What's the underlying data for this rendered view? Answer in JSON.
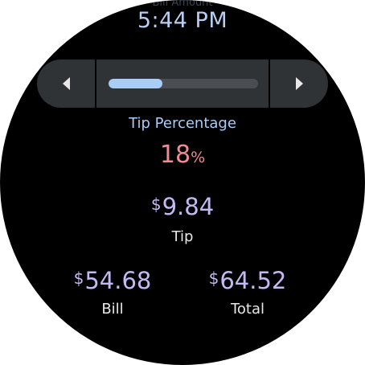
{
  "header": {
    "scrolled_label": "Bill Amount",
    "time": "5:44 PM"
  },
  "stepper": {
    "decrease_icon": "triangle-left-icon",
    "increase_icon": "triangle-right-icon",
    "level_fraction": 0.36
  },
  "tip_percentage": {
    "label": "Tip Percentage",
    "value": "18",
    "unit": "%"
  },
  "tip": {
    "currency": "$",
    "amount": "9.84",
    "label": "Tip"
  },
  "bill": {
    "currency": "$",
    "amount": "54.68",
    "label": "Bill"
  },
  "total": {
    "currency": "$",
    "amount": "64.52",
    "label": "Total"
  },
  "colors": {
    "accent_blue": "#a9cdf7",
    "accent_pink": "#f08a95",
    "accent_purple": "#c7b8f5",
    "background": "#000000"
  }
}
